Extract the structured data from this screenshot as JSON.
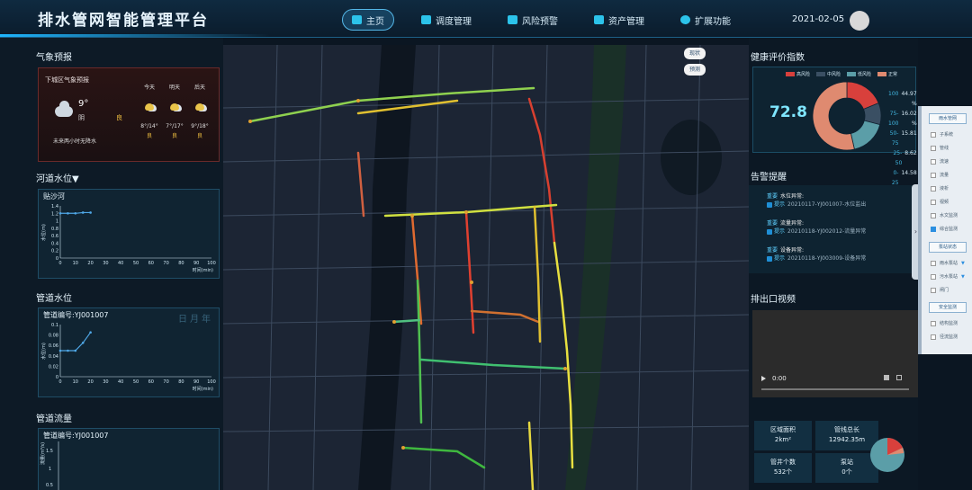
{
  "header": {
    "title": "排水管网智能管理平台",
    "nav": [
      "主页",
      "调度管理",
      "风险预警",
      "资产管理",
      "扩展功能"
    ],
    "active_index": 0,
    "date": "2021-02-05"
  },
  "weather": {
    "section_title": "气象预报",
    "district_label": "下城区气象预报",
    "current_temp": "9°",
    "current_cond": "阴",
    "current_aqi": "良",
    "rain_note": "未来两小时无降水",
    "forecast": [
      {
        "day": "今天",
        "temp": "8°/14°",
        "aqi": "良"
      },
      {
        "day": "明天",
        "temp": "7°/17°",
        "aqi": "良"
      },
      {
        "day": "后天",
        "temp": "9°/18°",
        "aqi": "良"
      }
    ]
  },
  "river_level": {
    "section_title": "河道水位▼",
    "station": "贴沙河",
    "ylabel": "水位(m)",
    "xlabel": "时间(min)"
  },
  "pipe_level": {
    "section_title": "管道水位",
    "pipe_id": "管道编号:YJ001007",
    "period_labels": "日月年",
    "ylabel": "水位(m)",
    "xlabel": "时间(min)"
  },
  "pipe_flow": {
    "section_title": "管道流量",
    "pipe_id": "管道编号:YJ001007",
    "ylabel": "流量(m³/s)",
    "yticks": [
      "1.5",
      "1",
      "0.5"
    ]
  },
  "chart_data": [
    {
      "type": "line",
      "title": "贴沙河",
      "xlabel": "时间(min)",
      "ylabel": "水位(m)",
      "x": [
        0,
        5,
        10,
        15,
        20
      ],
      "values": [
        1.2,
        1.2,
        1.2,
        1.22,
        1.22
      ],
      "xlim": [
        0,
        100
      ],
      "ylim": [
        0,
        1.4
      ],
      "xticks": [
        0,
        10,
        20,
        30,
        40,
        50,
        60,
        70,
        80,
        90,
        100
      ],
      "yticks": [
        0,
        0.2,
        0.4,
        0.6,
        0.8,
        1,
        1.2,
        1.4
      ]
    },
    {
      "type": "line",
      "title": "管道编号:YJ001007",
      "xlabel": "时间(min)",
      "ylabel": "水位(m)",
      "x": [
        0,
        5,
        10,
        15,
        20
      ],
      "values": [
        0.05,
        0.05,
        0.05,
        0.065,
        0.085
      ],
      "xlim": [
        0,
        100
      ],
      "ylim": [
        0,
        0.1
      ],
      "xticks": [
        0,
        10,
        20,
        30,
        40,
        50,
        60,
        70,
        80,
        90,
        100
      ],
      "yticks": [
        0,
        0.02,
        0.04,
        0.06,
        0.08,
        0.1
      ]
    },
    {
      "type": "pie",
      "title": "健康评价指数",
      "categories": [
        "高风险",
        "中风险",
        "低风险",
        "正常"
      ],
      "values": [
        15.81,
        8.62,
        14.58,
        44.97
      ],
      "colors": [
        "#d8403c",
        "#3a4f63",
        "#5b9ea8",
        "#df8a70"
      ]
    }
  ],
  "health": {
    "section_title": "健康评价指数",
    "legend": [
      "高风险",
      "中风险",
      "低风险",
      "正常"
    ],
    "colors": [
      "#d8403c",
      "#3a4f63",
      "#5b9ea8",
      "#df8a70"
    ],
    "score": "72.8",
    "table": [
      {
        "range": "100",
        "pct": "44.97 %"
      },
      {
        "range": "75-100",
        "pct": "16.02 %"
      },
      {
        "range": "50-75",
        "pct": "15.81"
      },
      {
        "range": "25-50",
        "pct": "8.62"
      },
      {
        "range": "0-25",
        "pct": "14.58"
      }
    ]
  },
  "alarms": {
    "section_title": "告警提醒",
    "items": [
      {
        "tag1": "重要",
        "tag2": "提示",
        "title": "水位异常:",
        "detail": "20210117-YJ001007-水位监出"
      },
      {
        "tag1": "重要",
        "tag2": "提示",
        "title": "流量异常:",
        "detail": "20210118-YJ002012-流量异常"
      },
      {
        "tag1": "重要",
        "tag2": "提示",
        "title": "设备异常:",
        "detail": "20210118-YJ003009-设备异常"
      }
    ]
  },
  "video": {
    "section_title": "排出口视频",
    "time": "0:00"
  },
  "stats": [
    {
      "label": "区域面积",
      "value": "2km²"
    },
    {
      "label": "管线总长",
      "value": "12942.35m"
    },
    {
      "label": "管井个数",
      "value": "532个"
    },
    {
      "label": "泵站",
      "value": "0个"
    }
  ],
  "map_buttons": [
    "现状",
    "预测"
  ],
  "layers": {
    "group1": "雨水管网",
    "group1_items": [
      {
        "label": "子系统",
        "on": false
      },
      {
        "label": "管线",
        "on": false
      },
      {
        "label": "流速",
        "on": false
      },
      {
        "label": "流量",
        "on": false
      },
      {
        "label": "液析",
        "on": false
      },
      {
        "label": "视频",
        "on": false
      },
      {
        "label": "水文监测",
        "on": false
      },
      {
        "label": "综合监测",
        "on": true
      }
    ],
    "group2": "泵站状态",
    "group2_items": [
      {
        "label": "雨水泵站",
        "on": false
      },
      {
        "label": "污水泵站",
        "on": false
      },
      {
        "label": "闸门",
        "on": false
      }
    ],
    "group3": "安全监测",
    "group3_items": [
      {
        "label": "结构监测",
        "on": false
      },
      {
        "label": "径流监测",
        "on": false
      }
    ]
  }
}
